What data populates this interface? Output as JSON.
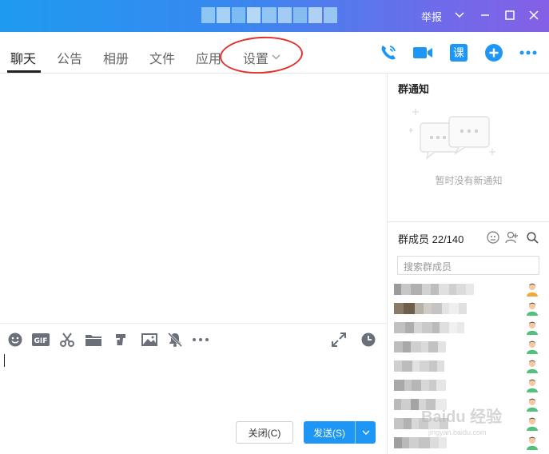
{
  "titlebar": {
    "report_label": "举报",
    "title_blur_colors": [
      "#8ec6f3",
      "#a8d2f5",
      "#7dbcf2",
      "#b5d8f6",
      "#92c4f2",
      "#a3cbf3",
      "#86bdf0",
      "#b0d1f3",
      "#98c5f1"
    ]
  },
  "tabs": {
    "items": [
      "聊天",
      "公告",
      "相册",
      "文件",
      "应用",
      "设置"
    ],
    "active": "聊天"
  },
  "toolbar": {
    "gif_label": "GIF",
    "close_label": "关闭(C)",
    "send_label": "发送(S)"
  },
  "notice": {
    "title": "群通知",
    "empty_text": "暂时没有新通知"
  },
  "members": {
    "title": "群成员 22/140",
    "search_placeholder": "搜索群成员",
    "rows": [
      [
        "#9b9b9b",
        "#c7c7c7",
        "#b0b0b0",
        "#d2d2d2",
        "#bdbdbd",
        "#e0e0e0",
        "#cfcfcf",
        "#dcdcdc",
        "#e8e8e8"
      ],
      [
        "#8a7b68",
        "#6f5e4a",
        "#b7b1a8",
        "#d0ccc6",
        "#c4c4c4",
        "#e4e4e4",
        "#efefef",
        "#e0e0e0"
      ],
      [
        "#c1c1c1",
        "#adadad",
        "#d6d6d6",
        "#c9c9c9",
        "#bababa",
        "#dedede",
        "#f0f0f0",
        "#e9e9e9"
      ],
      [
        "#bdbdbd",
        "#a9a9a9",
        "#cfcfcf",
        "#dadada",
        "#c2c2c2",
        "#e3e3e3"
      ],
      [
        "#cfcfcf",
        "#bcbcbc",
        "#e2e2e2",
        "#d4d4d4",
        "#c7c7c7",
        "#dedede"
      ],
      [
        "#a8a8a8",
        "#c6c6c6",
        "#b6b6b6",
        "#d8d8d8",
        "#cbcbcb",
        "#e6e6e6"
      ],
      [
        "#bababa",
        "#cecece",
        "#a4a4a4",
        "#d6d6d6",
        "#c2c2c2",
        "#eaeaea"
      ],
      [
        "#c4c4c4",
        "#b2b2b2",
        "#d8d8d8",
        "#cbcbcb",
        "#e0e0e0",
        "#d0d0d0"
      ],
      [
        "#9f9f9f",
        "#b9b9b9",
        "#cfcfcf",
        "#c4c4c4",
        "#dcdcdc",
        "#e8e8e8"
      ]
    ]
  },
  "watermark": {
    "text": "Baidu 经验",
    "sub": "jingyan.baidu.com"
  }
}
